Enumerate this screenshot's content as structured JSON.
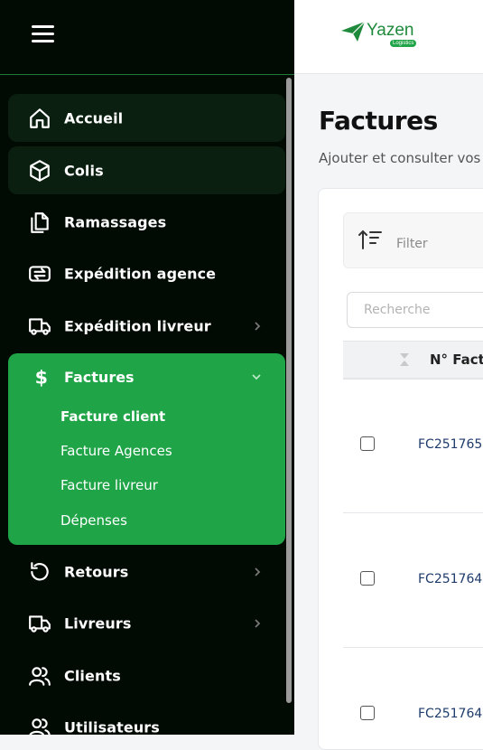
{
  "sidebar": {
    "items": [
      {
        "label": "Accueil",
        "icon": "home-icon"
      },
      {
        "label": "Colis",
        "icon": "box-icon"
      },
      {
        "label": "Ramassages",
        "icon": "documents-icon"
      },
      {
        "label": "Expédition agence",
        "icon": "transfer-icon"
      },
      {
        "label": "Expédition livreur",
        "icon": "truck-icon"
      },
      {
        "label": "Factures",
        "icon": "dollar-icon"
      },
      {
        "label": "Retours",
        "icon": "undo-icon"
      },
      {
        "label": "Livreurs",
        "icon": "truck-icon"
      },
      {
        "label": "Clients",
        "icon": "users-icon"
      },
      {
        "label": "Utilisateurs",
        "icon": "users-icon"
      }
    ],
    "factures_sub": [
      "Facture client",
      "Facture Agences",
      "Facture livreur",
      "Dépenses"
    ],
    "active_sub": "Facture client"
  },
  "logo": {
    "name": "Yazen",
    "tagline": "Logistics"
  },
  "main": {
    "title": "Factures",
    "subtitle": "Ajouter et consulter vos",
    "filter_label": "Filter",
    "search_placeholder": "Recherche",
    "column_header": "N° Factu",
    "rows": [
      {
        "number": "FC251765"
      },
      {
        "number": "FC251764"
      },
      {
        "number": "FC251764"
      }
    ]
  },
  "colors": {
    "sidebar_bg": "#020a04",
    "accent": "#1fa447",
    "link": "#1d3b6b"
  }
}
